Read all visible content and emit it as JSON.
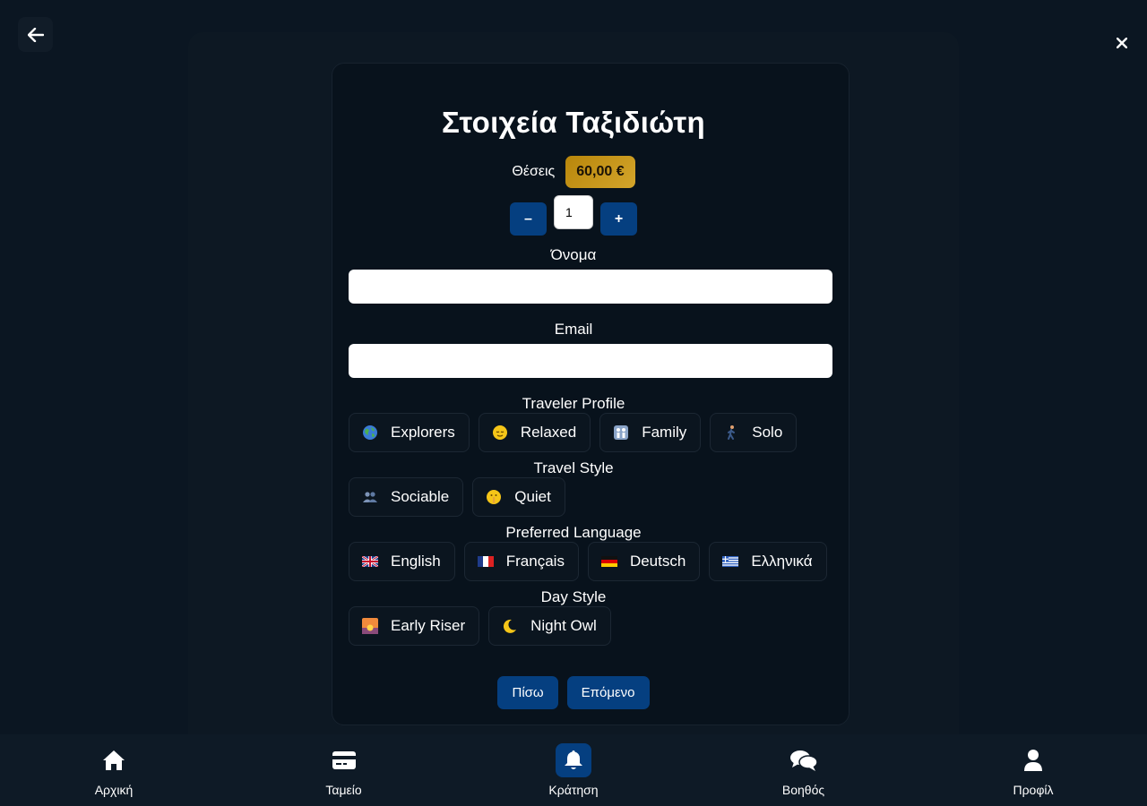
{
  "form": {
    "title": "Στοιχεία Ταξιδιώτη",
    "seats_label": "Θέσεις",
    "price": "60,00 €",
    "minus_label": "–",
    "plus_label": "+",
    "quantity": "1",
    "name_label": "Όνομα",
    "name_value": "",
    "email_label": "Email",
    "email_value": ""
  },
  "sections": {
    "traveler_profile": {
      "label": "Traveler Profile",
      "options": [
        {
          "label": "Explorers",
          "icon": "globe-icon"
        },
        {
          "label": "Relaxed",
          "icon": "relieved-face-icon"
        },
        {
          "label": "Family",
          "icon": "family-icon"
        },
        {
          "label": "Solo",
          "icon": "walking-person-icon"
        }
      ]
    },
    "travel_style": {
      "label": "Travel Style",
      "options": [
        {
          "label": "Sociable",
          "icon": "people-icon"
        },
        {
          "label": "Quiet",
          "icon": "shushing-face-icon"
        }
      ]
    },
    "preferred_language": {
      "label": "Preferred Language",
      "options": [
        {
          "label": "English",
          "icon": "uk-flag-icon"
        },
        {
          "label": "Français",
          "icon": "france-flag-icon"
        },
        {
          "label": "Deutsch",
          "icon": "germany-flag-icon"
        },
        {
          "label": "Ελληνικά",
          "icon": "greece-flag-icon"
        }
      ]
    },
    "day_style": {
      "label": "Day Style",
      "options": [
        {
          "label": "Early Riser",
          "icon": "sunrise-icon"
        },
        {
          "label": "Night Owl",
          "icon": "crescent-moon-icon"
        }
      ]
    }
  },
  "actions": {
    "back_label": "Πίσω",
    "next_label": "Επόμενο"
  },
  "nav": {
    "items": [
      {
        "label": "Αρχική",
        "icon": "home-icon"
      },
      {
        "label": "Ταμείο",
        "icon": "credit-card-icon"
      },
      {
        "label": "Κράτηση",
        "icon": "bell-icon",
        "active": true
      },
      {
        "label": "Βοηθός",
        "icon": "chat-icon"
      },
      {
        "label": "Προφίλ",
        "icon": "user-icon"
      }
    ]
  },
  "colors": {
    "background": "#0b1622",
    "accent": "#053f80",
    "price_gold": "#c99a1f"
  }
}
